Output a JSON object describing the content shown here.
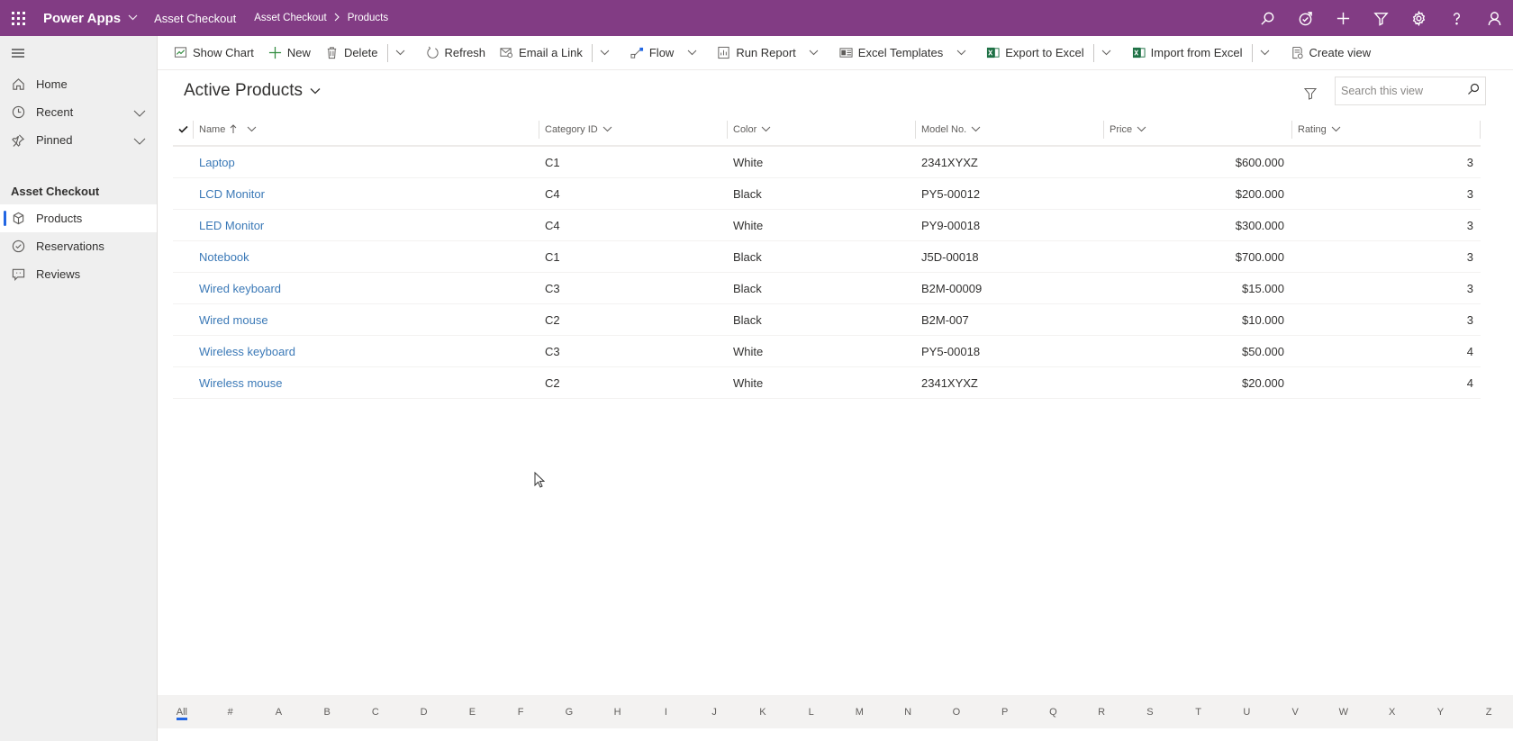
{
  "topbar": {
    "app_name": "Power Apps",
    "environment": "Asset Checkout",
    "breadcrumb": [
      "Asset Checkout",
      "Products"
    ],
    "icons": [
      "search-icon",
      "assistant-icon",
      "plus-icon",
      "filter-icon",
      "gear-icon",
      "help-icon",
      "user-icon"
    ],
    "brand_color": "#823c84"
  },
  "sidebar": {
    "items": [
      {
        "label": "Home",
        "icon": "home-icon"
      },
      {
        "label": "Recent",
        "icon": "clock-icon",
        "expandable": true
      },
      {
        "label": "Pinned",
        "icon": "pin-icon",
        "expandable": true
      }
    ],
    "group_title": "Asset Checkout",
    "group_items": [
      {
        "label": "Products",
        "icon": "cube-icon",
        "active": true
      },
      {
        "label": "Reservations",
        "icon": "check-circle-icon"
      },
      {
        "label": "Reviews",
        "icon": "comment-icon"
      }
    ]
  },
  "commands": {
    "show_chart": "Show Chart",
    "new": "New",
    "delete": "Delete",
    "refresh": "Refresh",
    "email_link": "Email a Link",
    "flow": "Flow",
    "run_report": "Run Report",
    "excel_templates": "Excel Templates",
    "export_excel": "Export to Excel",
    "import_excel": "Import from Excel",
    "create_view": "Create view"
  },
  "view": {
    "title": "Active Products",
    "search_placeholder": "Search this view",
    "search_value": ""
  },
  "grid": {
    "columns": [
      "Name",
      "Category ID",
      "Color",
      "Model No.",
      "Price",
      "Rating"
    ],
    "sort_column": "Name",
    "sort_direction": "ascending",
    "rows": [
      {
        "name": "Laptop",
        "category": "C1",
        "color": "White",
        "model": "2341XYXZ",
        "price": "$600.000",
        "rating": "3"
      },
      {
        "name": "LCD Monitor",
        "category": "C4",
        "color": "Black",
        "model": "PY5-00012",
        "price": "$200.000",
        "rating": "3"
      },
      {
        "name": "LED Monitor",
        "category": "C4",
        "color": "White",
        "model": "PY9-00018",
        "price": "$300.000",
        "rating": "3"
      },
      {
        "name": "Notebook",
        "category": "C1",
        "color": "Black",
        "model": "J5D-00018",
        "price": "$700.000",
        "rating": "3"
      },
      {
        "name": "Wired keyboard",
        "category": "C3",
        "color": "Black",
        "model": "B2M-00009",
        "price": "$15.000",
        "rating": "3"
      },
      {
        "name": "Wired mouse",
        "category": "C2",
        "color": "Black",
        "model": "B2M-007",
        "price": "$10.000",
        "rating": "3"
      },
      {
        "name": "Wireless keyboard",
        "category": "C3",
        "color": "White",
        "model": "PY5-00018",
        "price": "$50.000",
        "rating": "4"
      },
      {
        "name": "Wireless mouse",
        "category": "C2",
        "color": "White",
        "model": "2341XYXZ",
        "price": "$20.000",
        "rating": "4"
      }
    ]
  },
  "alphabet": {
    "active": "All",
    "letters": [
      "All",
      "#",
      "A",
      "B",
      "C",
      "D",
      "E",
      "F",
      "G",
      "H",
      "I",
      "J",
      "K",
      "L",
      "M",
      "N",
      "O",
      "P",
      "Q",
      "R",
      "S",
      "T",
      "U",
      "V",
      "W",
      "X",
      "Y",
      "Z"
    ]
  }
}
